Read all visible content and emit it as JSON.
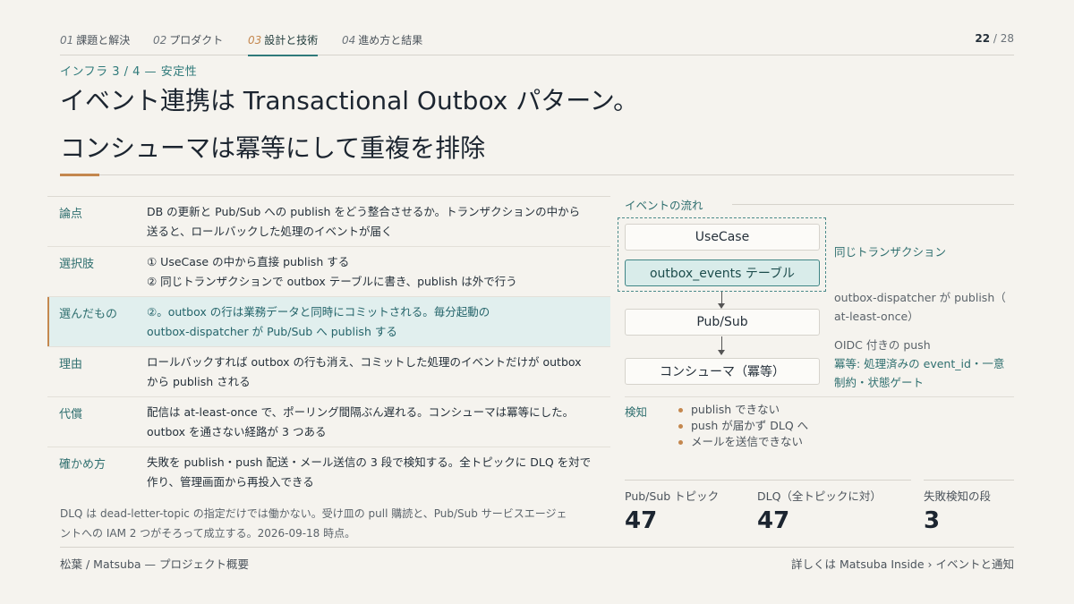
{
  "nav": {
    "tabs": [
      {
        "num": "01",
        "label": "課題と解決"
      },
      {
        "num": "02",
        "label": "プロダクト"
      },
      {
        "num": "03",
        "label": "設計と技術"
      },
      {
        "num": "04",
        "label": "進め方と結果"
      }
    ],
    "page_current": "22",
    "page_sep": " / ",
    "page_total": "28"
  },
  "header": {
    "subtitle": "インフラ 3 / 4 — 安定性",
    "title_line1": "イベント連携は Transactional Outbox パターン。",
    "title_line2": "コンシューマは冪等にして重複を排除"
  },
  "table": [
    {
      "label": "論点",
      "lines": [
        "DB の更新と Pub/Sub への publish をどう整合させるか。トランザクションの中から",
        "送ると、ロールバックした処理のイベントが届く"
      ]
    },
    {
      "label": "選択肢",
      "lines": [
        "① UseCase の中から直接 publish する",
        "② 同じトランザクションで outbox テーブルに書き、publish は外で行う"
      ]
    },
    {
      "label": "選んだもの",
      "lines": [
        "②。outbox の行は業務データと同時にコミットされる。毎分起動の",
        "outbox-dispatcher が Pub/Sub へ publish する"
      ]
    },
    {
      "label": "理由",
      "lines": [
        "ロールバックすれば outbox の行も消え、コミットした処理のイベントだけが outbox",
        "から publish される"
      ]
    },
    {
      "label": "代償",
      "lines": [
        "配信は at-least-once で、ポーリング間隔ぶん遅れる。コンシューマは冪等にした。",
        "outbox を通さない経路が 3 つある"
      ]
    },
    {
      "label": "確かめ方",
      "lines": [
        "失敗を publish・push 配送・メール送信の 3 段で検知する。全トピックに DLQ を対で",
        "作り、管理画面から再投入できる"
      ]
    }
  ],
  "note": {
    "lines": [
      "DLQ は dead-letter-topic の指定だけでは働かない。受け皿の pull 購読と、Pub/Sub サービスエージェ",
      "ントへの IAM 2 つがそろって成立する。2026-09-18 時点。"
    ]
  },
  "flow": {
    "label": "イベントの流れ",
    "box_usecase": "UseCase",
    "box_outbox": "outbox_events テーブル",
    "box_pubsub": "Pub/Sub",
    "box_consumer": "コンシューマ（冪等）",
    "side_tx": "同じトランザクション",
    "side_dispatch": [
      "outbox-dispatcher が publish（",
      "at-least-once）"
    ],
    "side_push": "OIDC 付きの push",
    "side_idem": [
      "冪等: 処理済みの event_id・一意",
      "制約・状態ゲート"
    ]
  },
  "detect": {
    "label": "検知",
    "items": [
      "publish できない",
      "push が届かず DLQ へ",
      "メールを送信できない"
    ]
  },
  "stats": [
    {
      "label": "Pub/Sub トピック",
      "value": "47"
    },
    {
      "label": "DLQ（全トピックに対）",
      "value": "47"
    },
    {
      "label": "失敗検知の段",
      "value": "3"
    }
  ],
  "footer": {
    "left": "松葉 / Matsuba — プロジェクト概要",
    "right": "詳しくは Matsuba Inside › イベントと通知"
  },
  "colors": {
    "accent_teal": "#2f7a7a",
    "accent_orange": "#c4874e",
    "background": "#f5f3ee",
    "highlight_row": "#e1efee"
  }
}
